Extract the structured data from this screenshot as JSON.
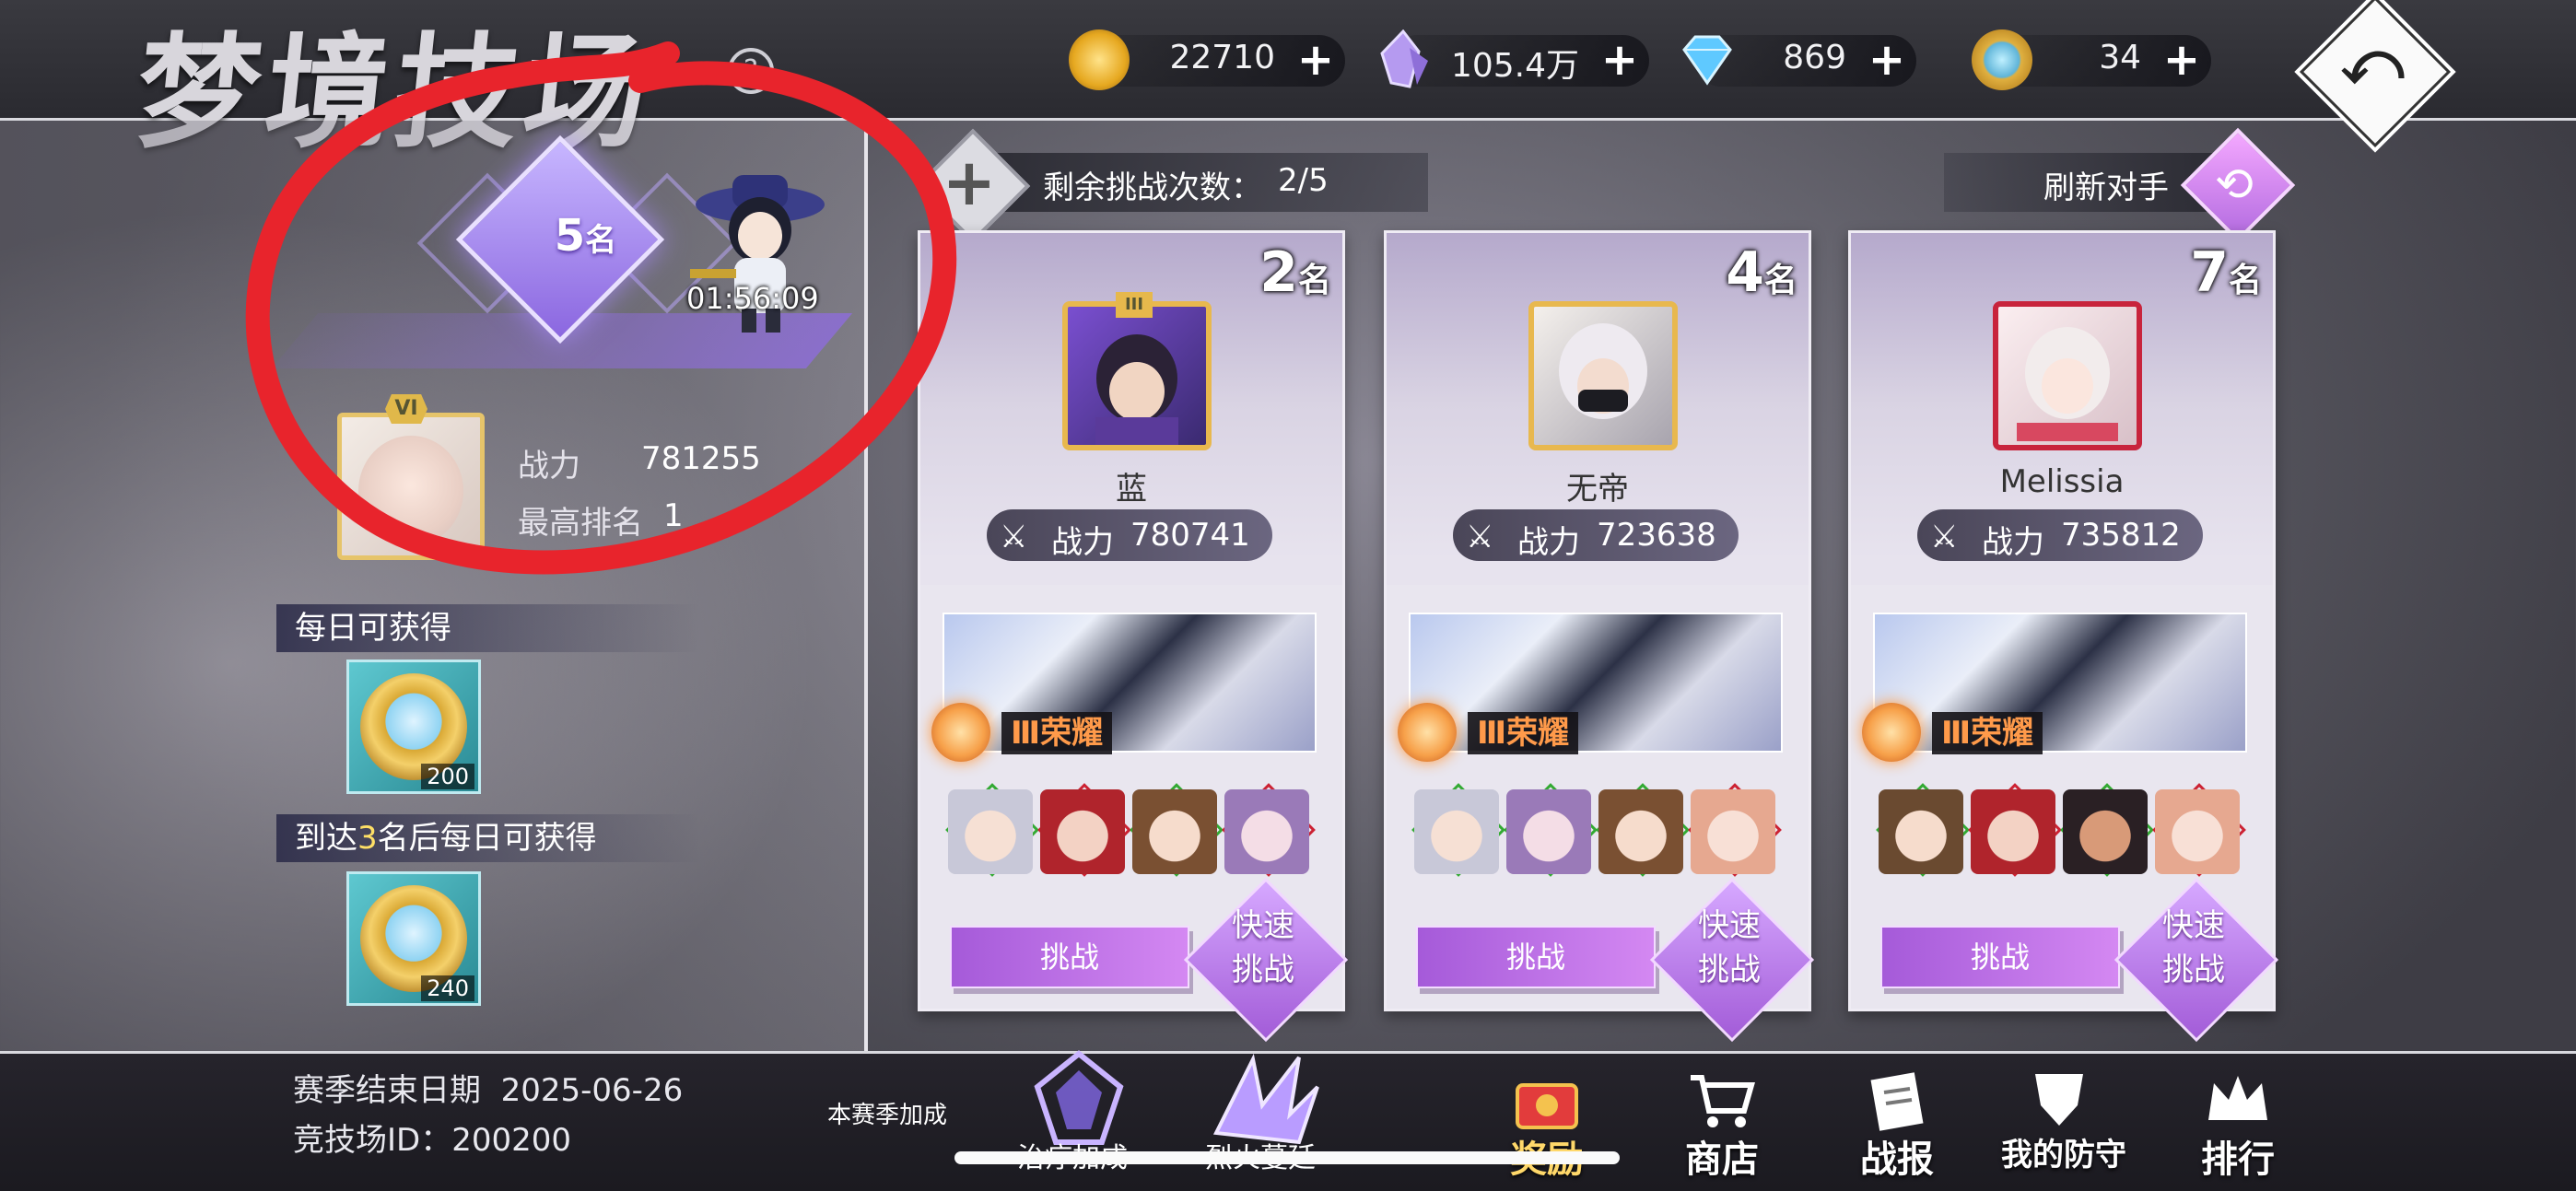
{
  "header": {
    "title": "梦境技场",
    "help": "?"
  },
  "resources": {
    "gold": "22710",
    "crystal": "105.4万",
    "diamond": "869",
    "ticket": "34",
    "plus": "+"
  },
  "back_button": "⤺",
  "player": {
    "rank_number": "5",
    "rank_suffix": "名",
    "timer": "01:56:09",
    "level_badge": "VI",
    "power_label": "战力",
    "power_value": "781255",
    "best_rank_label": "最高排名",
    "best_rank_value": "1"
  },
  "rewards": {
    "daily_title": "每日可获得",
    "daily_count": "200",
    "rank3_title_prefix": "到达",
    "rank3_number": "3",
    "rank3_title_suffix": "名后每日可获得",
    "rank3_count": "240"
  },
  "challenges": {
    "label": "剩余挑战次数：",
    "value": "2/5",
    "refresh_label": "刷新对手"
  },
  "opponents": [
    {
      "rank": "2",
      "rank_suffix": "名",
      "tier": "III",
      "name": "蓝",
      "power_label": "战力",
      "power": "780741",
      "glory": "Ⅲ荣耀",
      "challenge": "挑战",
      "quick_1": "快速",
      "quick_2": "挑战"
    },
    {
      "rank": "4",
      "rank_suffix": "名",
      "name": "无帝",
      "power_label": "战力",
      "power": "723638",
      "glory": "Ⅲ荣耀",
      "challenge": "挑战",
      "quick_1": "快速",
      "quick_2": "挑战"
    },
    {
      "rank": "7",
      "rank_suffix": "名",
      "name": "Melissia",
      "power_label": "战力",
      "power": "735812",
      "glory": "Ⅲ荣耀",
      "challenge": "挑战",
      "quick_1": "快速",
      "quick_2": "挑战"
    }
  ],
  "footer": {
    "season_end_label": "赛季结束日期",
    "season_end_date": "2025-06-26",
    "arena_id_label": "竞技场ID：",
    "arena_id": "200200",
    "season_bonus": "本赛季加成",
    "bonus1": "治疗加成",
    "bonus2": "烈火蔓延"
  },
  "nav": {
    "rewards": "奖励",
    "shop": "商店",
    "battle_report": "战报",
    "my_defense": "我的防守",
    "ranking": "排行"
  },
  "colors": {
    "accent_purple": "#b36be0",
    "gold": "#e8b84e",
    "glory_orange": "#ff9a4a",
    "annotation_red": "#e8242c"
  }
}
